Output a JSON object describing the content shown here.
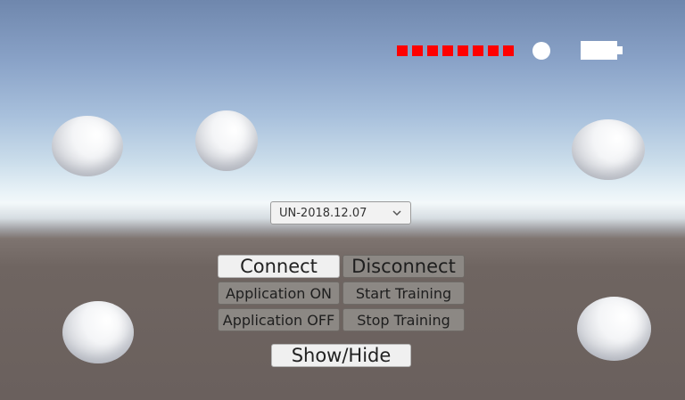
{
  "scene": {
    "spheres": [
      "sphere-top-left",
      "sphere-top-mid-left",
      "sphere-top-right",
      "sphere-bottom-left",
      "sphere-bottom-right"
    ]
  },
  "status": {
    "signal_bars": 8,
    "signal_color": "#ff0000",
    "indicator_icon": "status-dot-icon",
    "battery_icon": "battery-full-icon"
  },
  "device_select": {
    "selected": "UN-2018.12.07",
    "icon": "chevron-down-icon"
  },
  "buttons": {
    "connect": "Connect",
    "disconnect": "Disconnect",
    "app_on": "Application ON",
    "start_training": "Start Training",
    "app_off": "Application OFF",
    "stop_training": "Stop Training",
    "show_hide": "Show/Hide"
  }
}
